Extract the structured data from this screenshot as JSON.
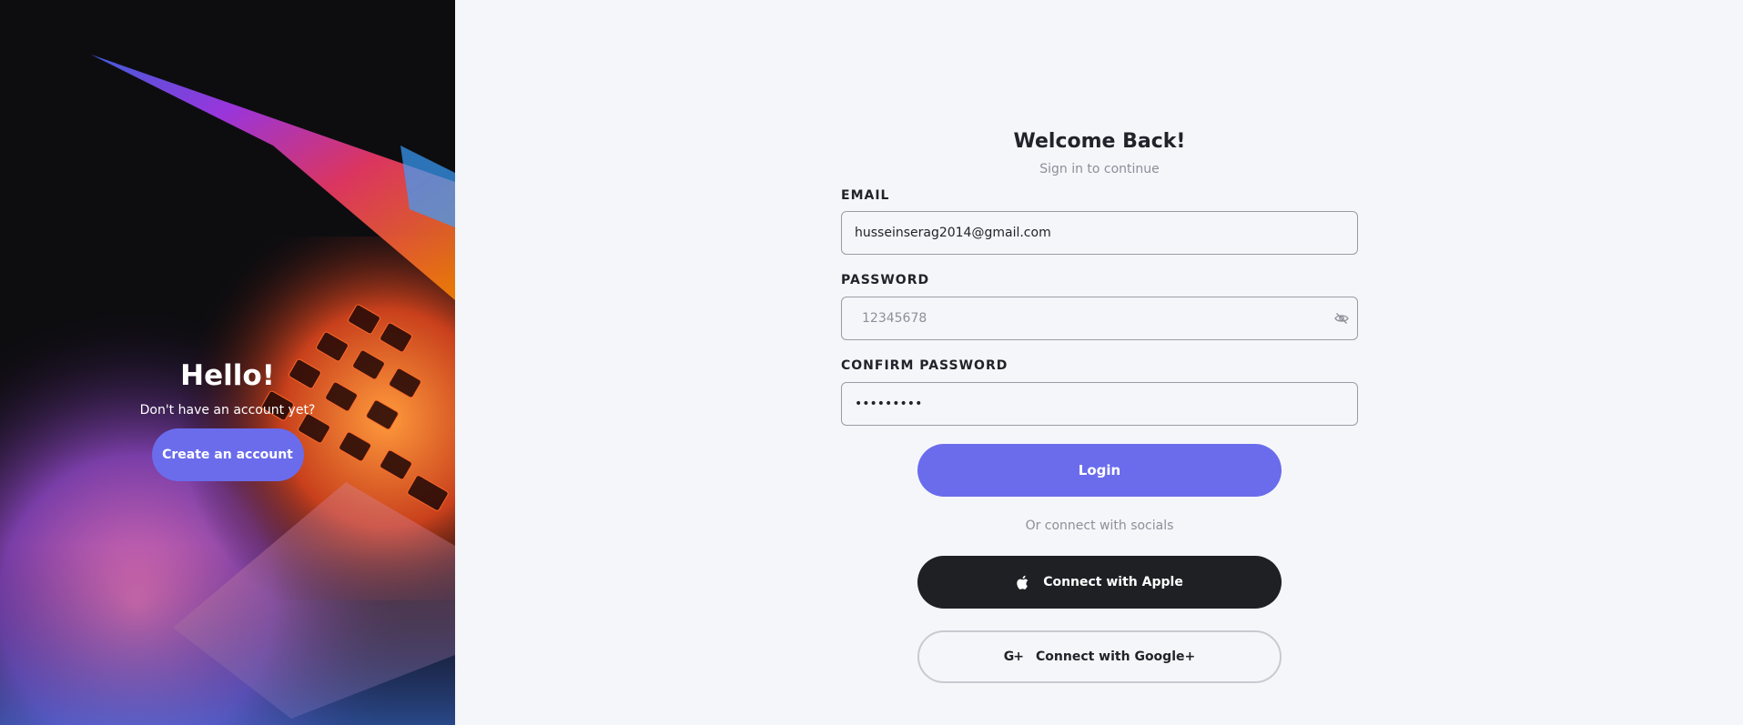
{
  "hero": {
    "title": "Hello!",
    "subtitle": "Don't have an account yet?",
    "create_account_label": "Create an account"
  },
  "form": {
    "title": "Welcome Back!",
    "subtitle": "Sign in to continue",
    "email_label": "EMAIL",
    "email_value": "husseinserag2014@gmail.com",
    "password_label": "PASSWORD",
    "password_placeholder": "12345678",
    "confirm_label": "CONFIRM PASSWORD",
    "confirm_value": "•••••••••",
    "login_label": "Login",
    "socials_label": "Or connect with socials",
    "apple_label": "Connect with Apple",
    "google_label": "Connect with Google+",
    "google_icon_text": "G+"
  },
  "icons": {
    "password_toggle": "eye-off-icon",
    "apple": "apple-icon",
    "google": "google-plus-icon"
  },
  "colors": {
    "accent": "#6a6cec",
    "apple_button": "#1f2023",
    "background": "#f5f6fa",
    "hero_background": "#0d0d10"
  }
}
